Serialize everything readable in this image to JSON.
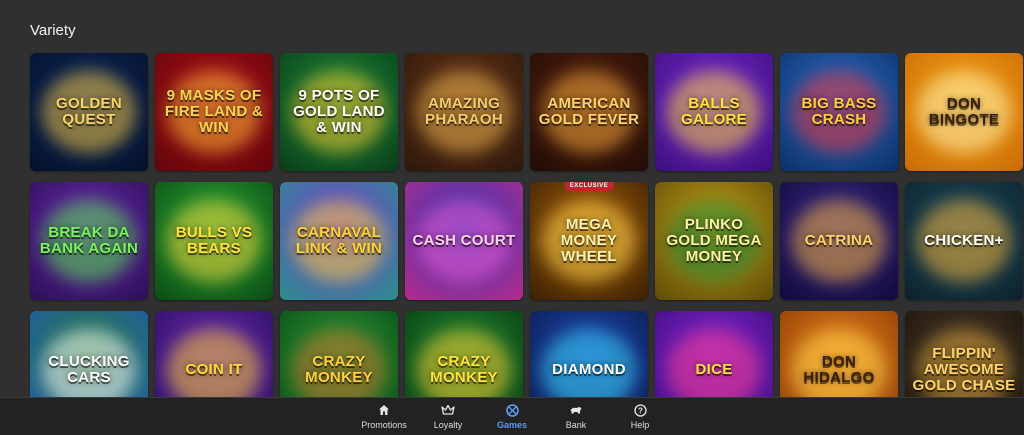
{
  "section": {
    "title": "Variety"
  },
  "games": [
    {
      "name": "Golden Quest",
      "bg": "#0d2a5c",
      "bg2": "#041029",
      "accent": "#f5c542",
      "text": "#f7d36a"
    },
    {
      "name": "9 Masks of Fire Land & Win",
      "bg": "#b3121d",
      "bg2": "#5e0509",
      "accent": "#f7b733",
      "text": "#ffd34d"
    },
    {
      "name": "9 Pots of Gold Land & Win",
      "bg": "#1c8a3a",
      "bg2": "#0a3d18",
      "accent": "#f3c530",
      "text": "#ffffff"
    },
    {
      "name": "Amazing Pharaoh",
      "bg": "#6b3a1b",
      "bg2": "#2b160a",
      "accent": "#e8b04b",
      "text": "#f3cc6b"
    },
    {
      "name": "American Gold Fever",
      "bg": "#5b2410",
      "bg2": "#1e0b05",
      "accent": "#f0a63a",
      "text": "#ffd36b"
    },
    {
      "name": "Balls Galore",
      "bg": "#7b2ad6",
      "bg2": "#3a0f7a",
      "accent": "#f6d33c",
      "text": "#ffe23a"
    },
    {
      "name": "Big Bass Crash",
      "bg": "#2a6ec9",
      "bg2": "#0c2f66",
      "accent": "#e8323a",
      "text": "#ffcf3a"
    },
    {
      "name": "Don Bingote",
      "bg": "#f4a215",
      "bg2": "#c96a06",
      "accent": "#fff3b0",
      "text": "#3a1f08"
    },
    {
      "name": "Break da Bank Again",
      "bg": "#6a2bb0",
      "bg2": "#2b0f55",
      "accent": "#55e04a",
      "text": "#79f25c"
    },
    {
      "name": "Bulls vs Bears",
      "bg": "#2aa836",
      "bg2": "#0b4a14",
      "accent": "#f3d23b",
      "text": "#ffe23a"
    },
    {
      "name": "Carnaval Link & Win",
      "bg": "#7a3bd6",
      "bg2": "#2a8f8a",
      "accent": "#f7d33a",
      "text": "#ffd23a"
    },
    {
      "name": "Cash Court",
      "bg": "#2b3bb8",
      "bg2": "#b82a8a",
      "accent": "#f65ad2",
      "text": "#ffd2f2"
    },
    {
      "name": "Mega Money Wheel",
      "bg": "#a8620a",
      "bg2": "#3a1f02",
      "accent": "#ffd34d",
      "text": "#fff2b0",
      "badge": "EXCLUSIVE"
    },
    {
      "name": "Plinko Gold Mega Money",
      "bg": "#c9a21a",
      "bg2": "#5c4a06",
      "accent": "#1e8a3a",
      "text": "#fff2a0"
    },
    {
      "name": "Catrina",
      "bg": "#3a2a8a",
      "bg2": "#12093a",
      "accent": "#f0b03a",
      "text": "#ffd36b"
    },
    {
      "name": "Chicken+",
      "bg": "#1e4a5c",
      "bg2": "#0c222c",
      "accent": "#f3b23a",
      "text": "#ffffff"
    },
    {
      "name": "Clucking Cars",
      "bg": "#2a7a3a",
      "bg2": "#1e5ab0",
      "accent": "#ffffff",
      "text": "#ffffff"
    },
    {
      "name": "Coin It",
      "bg": "#6a2ab8",
      "bg2": "#2a0f5c",
      "accent": "#f7c830",
      "text": "#ffd93a"
    },
    {
      "name": "Crazy Monkey",
      "bg": "#2a9a3a",
      "bg2": "#0a4a14",
      "accent": "#c8702a",
      "text": "#ffd23a"
    },
    {
      "name": "Crazy Monkey",
      "bg": "#1e8a34",
      "bg2": "#0a3a10",
      "accent": "#f7c830",
      "text": "#ffe23a"
    },
    {
      "name": "Diamond",
      "bg": "#1e4ab8",
      "bg2": "#0a1a4a",
      "accent": "#3ad2f2",
      "text": "#ffffff"
    },
    {
      "name": "Dice",
      "bg": "#8a2ad6",
      "bg2": "#3a0a7a",
      "accent": "#f23a8a",
      "text": "#ffe23a"
    },
    {
      "name": "Don Hidalgo",
      "bg": "#e8821a",
      "bg2": "#8a3a06",
      "accent": "#ffd34d",
      "text": "#3a1f08"
    },
    {
      "name": "Flippin' Awesome Gold Chase",
      "bg": "#4a3a2a",
      "bg2": "#1a130a",
      "accent": "#d8a23a",
      "text": "#ffd36b"
    }
  ],
  "nav": {
    "items": [
      {
        "label": "Promotions",
        "icon": "home-icon"
      },
      {
        "label": "Loyalty",
        "icon": "crown-icon"
      },
      {
        "label": "Games",
        "icon": "games-icon",
        "active": true
      },
      {
        "label": "Bank",
        "icon": "bank-icon"
      },
      {
        "label": "Help",
        "icon": "help-icon"
      }
    ],
    "active_color": "#5b9cf6"
  }
}
